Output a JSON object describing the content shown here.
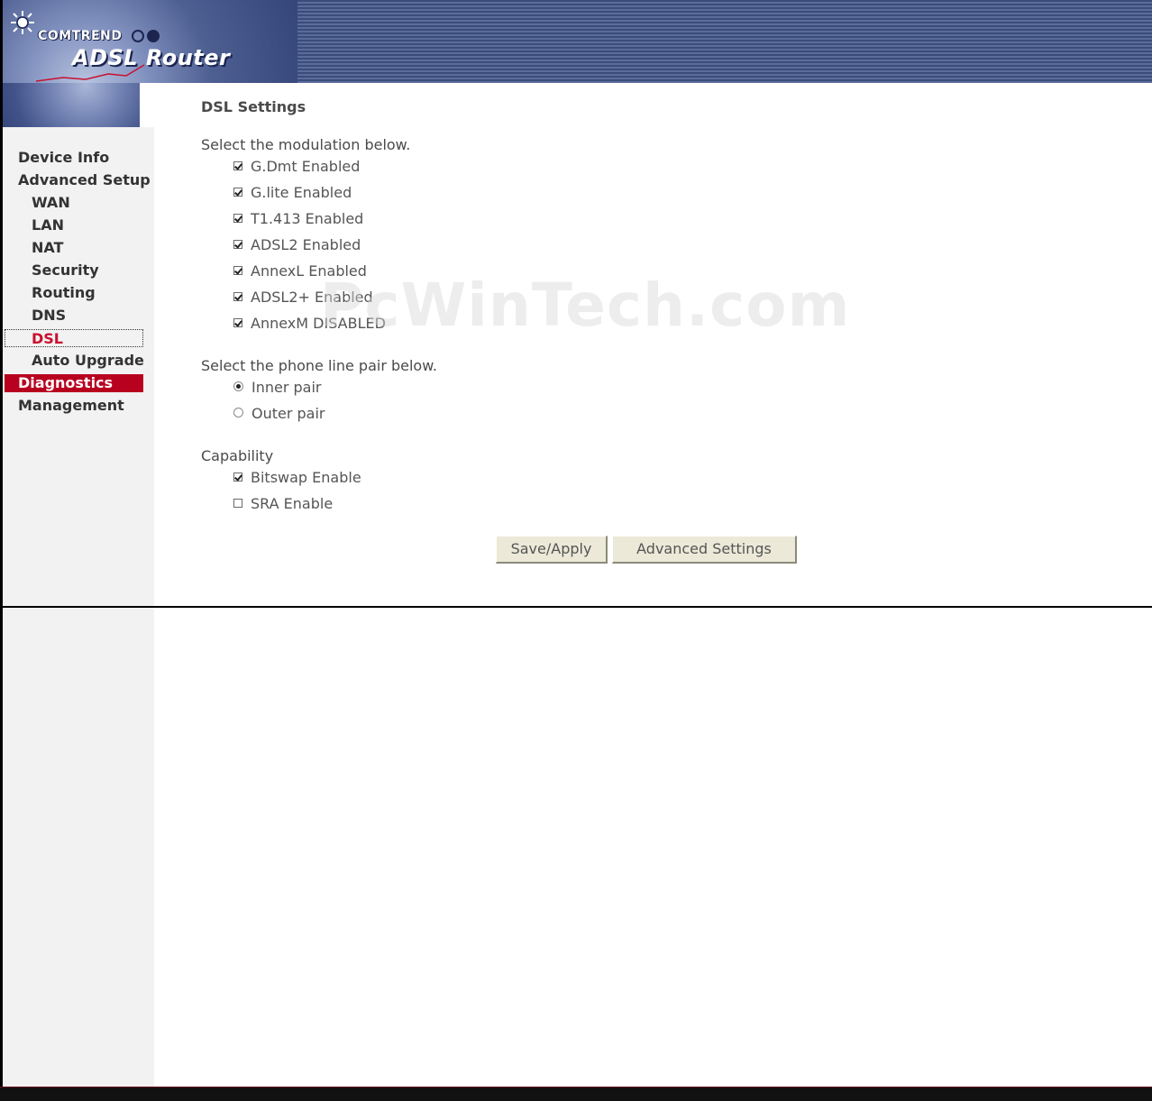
{
  "header": {
    "brand": "COMTREND",
    "product": "ADSL Router",
    "colors": {
      "band_dark": "#3b4c7c",
      "band_light": "#5a6c99"
    }
  },
  "sidebar": {
    "items": [
      {
        "label": "Device Info",
        "level": 0,
        "state": "normal"
      },
      {
        "label": "Advanced Setup",
        "level": 0,
        "state": "normal"
      },
      {
        "label": "WAN",
        "level": 1,
        "state": "normal"
      },
      {
        "label": "LAN",
        "level": 1,
        "state": "normal"
      },
      {
        "label": "NAT",
        "level": 1,
        "state": "normal"
      },
      {
        "label": "Security",
        "level": 1,
        "state": "normal"
      },
      {
        "label": "Routing",
        "level": 1,
        "state": "normal"
      },
      {
        "label": "DNS",
        "level": 1,
        "state": "normal"
      },
      {
        "label": "DSL",
        "level": 1,
        "state": "current"
      },
      {
        "label": "Auto Upgrade",
        "level": 1,
        "state": "normal"
      },
      {
        "label": "Diagnostics",
        "level": 0,
        "state": "highlight"
      },
      {
        "label": "Management",
        "level": 0,
        "state": "normal"
      }
    ],
    "colors": {
      "current_text": "#c8102e",
      "highlight_bg": "#b8001f"
    }
  },
  "main": {
    "title": "DSL Settings",
    "modulation": {
      "label": "Select the modulation below.",
      "options": [
        {
          "label": "G.Dmt Enabled",
          "checked": true
        },
        {
          "label": "G.lite Enabled",
          "checked": true
        },
        {
          "label": "T1.413 Enabled",
          "checked": true
        },
        {
          "label": "ADSL2 Enabled",
          "checked": true
        },
        {
          "label": "AnnexL Enabled",
          "checked": true
        },
        {
          "label": "ADSL2+ Enabled",
          "checked": true
        },
        {
          "label": "AnnexM DISABLED",
          "checked": true
        }
      ]
    },
    "phone_line": {
      "label": "Select the phone line pair below.",
      "options": [
        {
          "label": "Inner pair",
          "selected": true
        },
        {
          "label": "Outer pair",
          "selected": false
        }
      ]
    },
    "capability": {
      "label": "Capability",
      "options": [
        {
          "label": "Bitswap Enable",
          "checked": true
        },
        {
          "label": "SRA Enable",
          "checked": false
        }
      ]
    },
    "buttons": {
      "save_apply": "Save/Apply",
      "advanced_settings": "Advanced Settings"
    }
  },
  "watermark": "PcWinTech.com"
}
